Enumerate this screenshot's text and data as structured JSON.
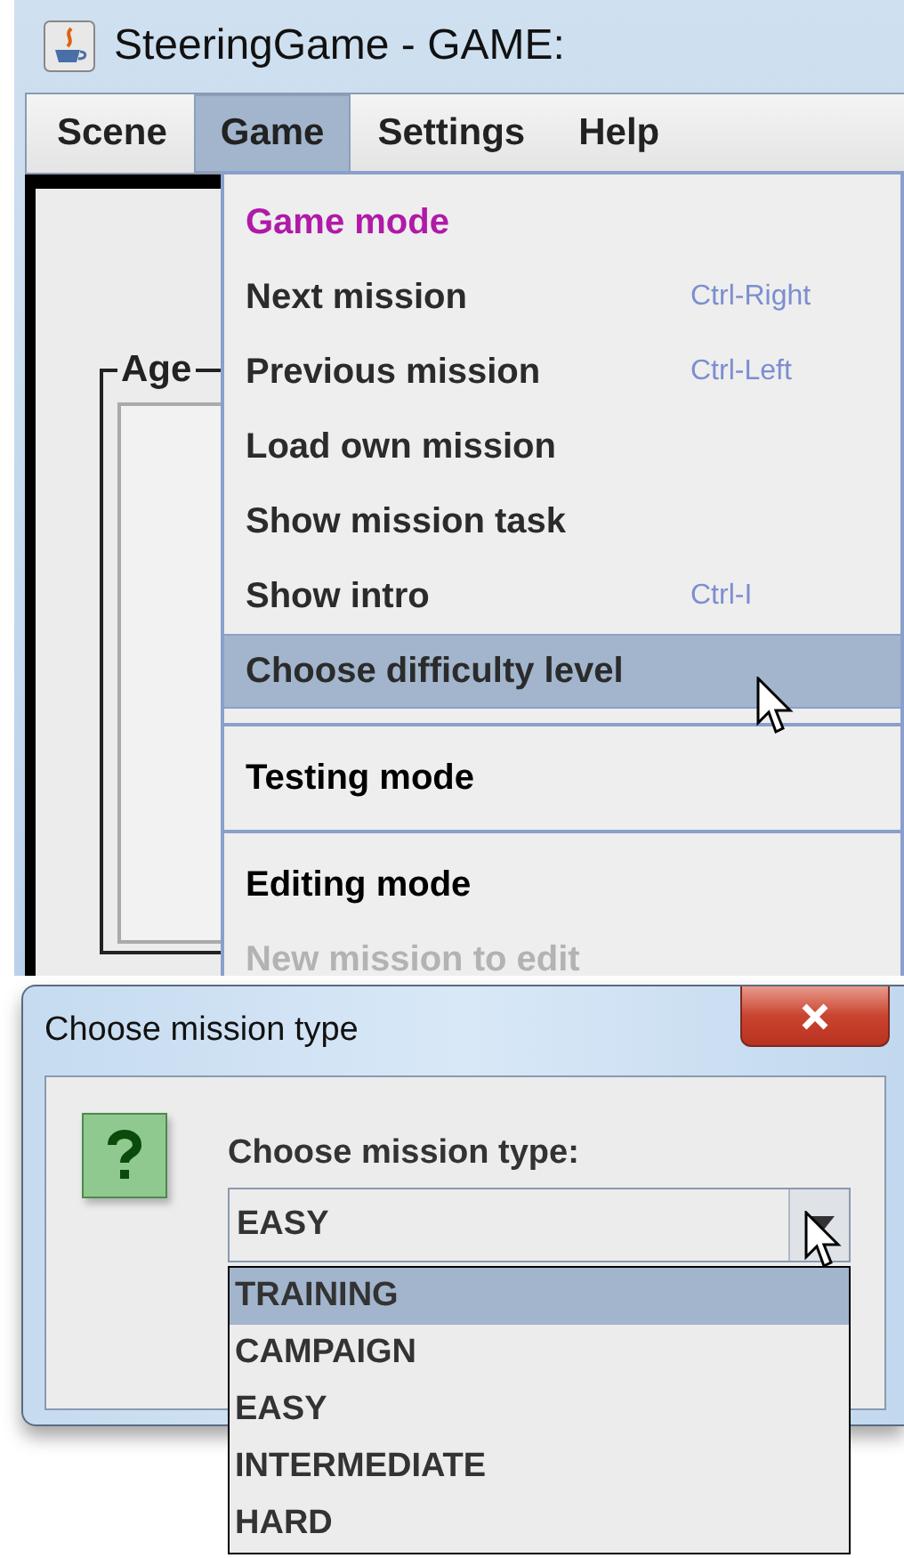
{
  "window": {
    "title": "SteeringGame - GAME:"
  },
  "menubar": [
    {
      "label": "Scene",
      "selected": false
    },
    {
      "label": "Game",
      "selected": true
    },
    {
      "label": "Settings",
      "selected": false
    },
    {
      "label": "Help",
      "selected": false
    }
  ],
  "background": {
    "group_label": "Age"
  },
  "menu": {
    "items": [
      {
        "kind": "section",
        "label": "Game mode",
        "selected": true
      },
      {
        "kind": "item",
        "label": "Next mission",
        "shortcut": "Ctrl-Right",
        "selected": false,
        "disabled": false
      },
      {
        "kind": "item",
        "label": "Previous mission",
        "shortcut": "Ctrl-Left",
        "selected": false,
        "disabled": false
      },
      {
        "kind": "item",
        "label": "Load own mission",
        "selected": false,
        "disabled": false
      },
      {
        "kind": "item",
        "label": "Show mission task",
        "selected": false,
        "disabled": false
      },
      {
        "kind": "item",
        "label": "Show intro",
        "shortcut": "Ctrl-I",
        "selected": false,
        "disabled": false
      },
      {
        "kind": "item",
        "label": "Choose difficulty level",
        "selected": true,
        "disabled": false
      },
      {
        "kind": "separator"
      },
      {
        "kind": "section",
        "label": "Testing mode",
        "selected": false
      },
      {
        "kind": "separator"
      },
      {
        "kind": "section",
        "label": "Editing mode",
        "selected": false
      },
      {
        "kind": "item",
        "label": "New mission to edit",
        "selected": false,
        "disabled": true
      }
    ]
  },
  "dialog": {
    "title": "Choose mission type",
    "prompt": "Choose mission type:",
    "combo": {
      "value": "EASY",
      "expanded": true,
      "options": [
        {
          "label": "TRAINING",
          "highlighted": true
        },
        {
          "label": "CAMPAIGN",
          "highlighted": false
        },
        {
          "label": "EASY",
          "highlighted": false
        },
        {
          "label": "INTERMEDIATE",
          "highlighted": false
        },
        {
          "label": "HARD",
          "highlighted": false
        }
      ]
    }
  }
}
